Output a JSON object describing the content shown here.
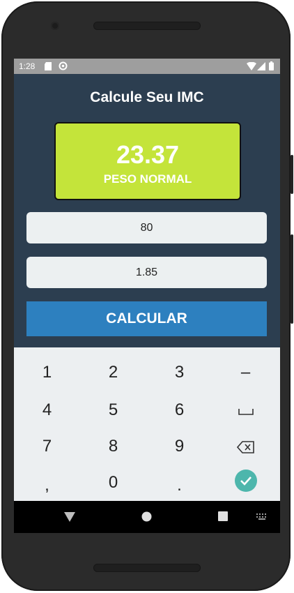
{
  "status_bar": {
    "time": "1:28"
  },
  "app": {
    "title": "Calcule Seu IMC",
    "result": {
      "value": "23.37",
      "label": "PESO NORMAL"
    },
    "weight_input": {
      "value": "80"
    },
    "height_input": {
      "value": "1.85"
    },
    "calculate_button": "CALCULAR"
  },
  "keyboard": {
    "rows": [
      [
        "1",
        "2",
        "3",
        "–"
      ],
      [
        "4",
        "5",
        "6",
        "space"
      ],
      [
        "7",
        "8",
        "9",
        "backspace"
      ],
      [
        ",",
        "0",
        ".",
        "done"
      ]
    ],
    "keys": {
      "k1": "1",
      "k2": "2",
      "k3": "3",
      "minus": "–",
      "k4": "4",
      "k5": "5",
      "k6": "6",
      "k7": "7",
      "k8": "8",
      "k9": "9",
      "comma": ",",
      "k0": "0",
      "dot": "."
    }
  },
  "colors": {
    "background": "#2c3e50",
    "result_box": "#c4e43a",
    "button": "#2d80bf",
    "input": "#ecf0f1",
    "done_key": "#4db6ac"
  }
}
